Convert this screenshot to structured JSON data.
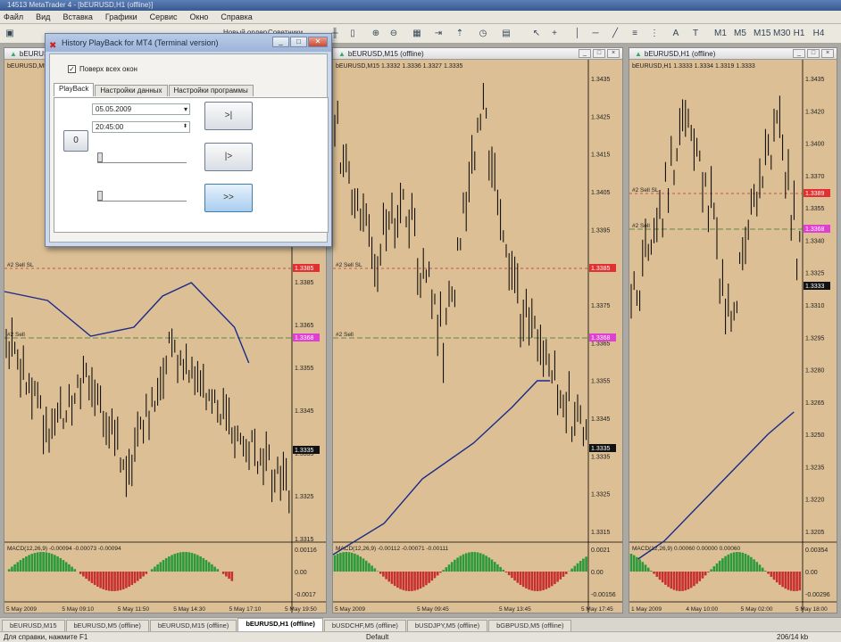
{
  "app": {
    "title": "14513 MetaTrader 4 - [bEURUSD,H1 (offline)]"
  },
  "menu": [
    "Файл",
    "Вид",
    "Вставка",
    "Графики",
    "Сервис",
    "Окно",
    "Справка"
  ],
  "toolbar": {
    "new_order_label": "Новый ордер",
    "expert_label": "Советники"
  },
  "windows": [
    {
      "title": "bEURUSD,M5 (offline)",
      "info": "bEURUSD,M5 (offline)"
    },
    {
      "title": "bEURUSD,M15 (offline)",
      "info": "bEURUSD,M15  1.3332 1.3336 1.3327 1.3335"
    },
    {
      "title": "bEURUSD,H1 (offline)",
      "info": "bEURUSD,H1  1.3333 1.3334 1.3319 1.3333"
    }
  ],
  "chart_data": [
    {
      "type": "line",
      "title": "bEURUSD,M5 (offline)",
      "price_ticks": [
        "1.3385",
        "1.3365",
        "1.3355",
        "1.3345",
        "1.3335",
        "1.3325",
        "1.3315"
      ],
      "time_ticks": [
        "5 May 2009",
        "5 May 09:10",
        "5 May 11:50",
        "5 May 14:30",
        "5 May 17:10",
        "5 May 19:50"
      ],
      "order_labels": [
        "#2 Sell SL",
        "#2 Sell"
      ],
      "price_tags": [
        "1.3385",
        "1.3368",
        "1.3335"
      ],
      "macd": {
        "label": "MACD(12,26,9) -0.00094 -0.00073 -0.00094",
        "ticks": [
          "0.00116",
          "0.00",
          "-0.0017"
        ]
      }
    },
    {
      "type": "line",
      "title": "bEURUSD,M15 (offline)",
      "price_ticks": [
        "1.3435",
        "1.3425",
        "1.3415",
        "1.3405",
        "1.3395",
        "1.3385",
        "1.3375",
        "1.3365",
        "1.3355",
        "1.3345",
        "1.3335",
        "1.3325",
        "1.3315"
      ],
      "time_ticks": [
        "5 May 2009",
        "5 May 09:45",
        "5 May 13:45",
        "5 May 17:45"
      ],
      "order_labels": [
        "#2 Sell SL",
        "#2 Sell"
      ],
      "price_tags": [
        "1.3385",
        "1.3368",
        "1.3335"
      ],
      "macd": {
        "label": "MACD(12,26,9) -0.00112 -0.00071 -0.00111",
        "ticks": [
          "0.0021",
          "0.00",
          "-0.00156"
        ]
      }
    },
    {
      "type": "line",
      "title": "bEURUSD,H1 (offline)",
      "price_ticks": [
        "1.3435",
        "1.3420",
        "1.3400",
        "1.3370",
        "1.3355",
        "1.3340",
        "1.3325",
        "1.3310",
        "1.3295",
        "1.3280",
        "1.3265",
        "1.3250",
        "1.3235",
        "1.3220",
        "1.3205"
      ],
      "time_ticks": [
        "1 May 2009",
        "4 May 10:00",
        "5 May 02:00",
        "5 May 18:00"
      ],
      "order_labels": [
        "#2 Sell SL",
        "#2 Sell"
      ],
      "price_tags": [
        "1.3389",
        "1.3368",
        "1.3333"
      ],
      "macd": {
        "label": "MACD(12,26,9) 0.00060 0.00000 0.00060",
        "ticks": [
          "0.00354",
          "0.00",
          "-0.00296"
        ]
      }
    }
  ],
  "dialog": {
    "title": "History PlayBack for MT4 (Terminal version)",
    "always_on_top": "Поверх всех окон",
    "tabs": [
      "PlayBack",
      "Настройки данных",
      "Настройки программы"
    ],
    "date_value": "05.05.2009",
    "time_value": "20:45:00",
    "btn_stop": "0",
    "btn_step": ">|",
    "btn_play": "|>",
    "btn_fast": ">>"
  },
  "tabs": [
    "bEURUSD,M15",
    "bEURUSD,M5 (offline)",
    "bEURUSD,M15 (offline)",
    "bEURUSD,H1 (offline)",
    "bUSDCHF,M5 (offline)",
    "bUSDJPY,M5 (offline)",
    "bGBPUSD,M5 (offline)"
  ],
  "status": {
    "help": "Для справки, нажмите F1",
    "profile": "Default",
    "traffic": "206/14 kb"
  }
}
